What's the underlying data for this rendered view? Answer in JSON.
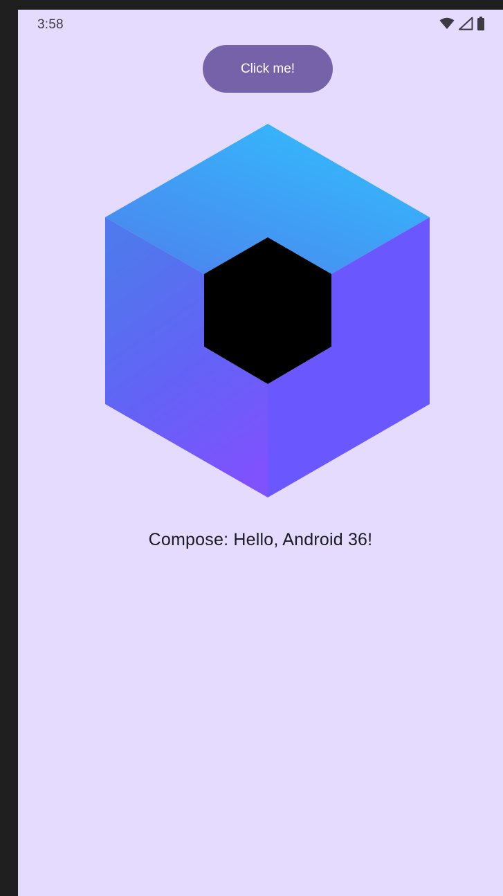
{
  "status_bar": {
    "time": "3:58",
    "icons": [
      "wifi-icon",
      "cell-signal-icon",
      "battery-icon"
    ]
  },
  "main": {
    "button_label": "Click me!",
    "greeting": "Compose: Hello, Android 36!",
    "logo_icon": "jetpack-compose-logo"
  },
  "colors": {
    "screen_background": "#e4dbff",
    "button": "#7562a8",
    "logo_top_light": "#35b8fb",
    "logo_top_dark": "#4a8af1",
    "logo_right": "#6b57fe",
    "logo_left_bottom": "#7f52fe",
    "logo_center": "#000000"
  }
}
